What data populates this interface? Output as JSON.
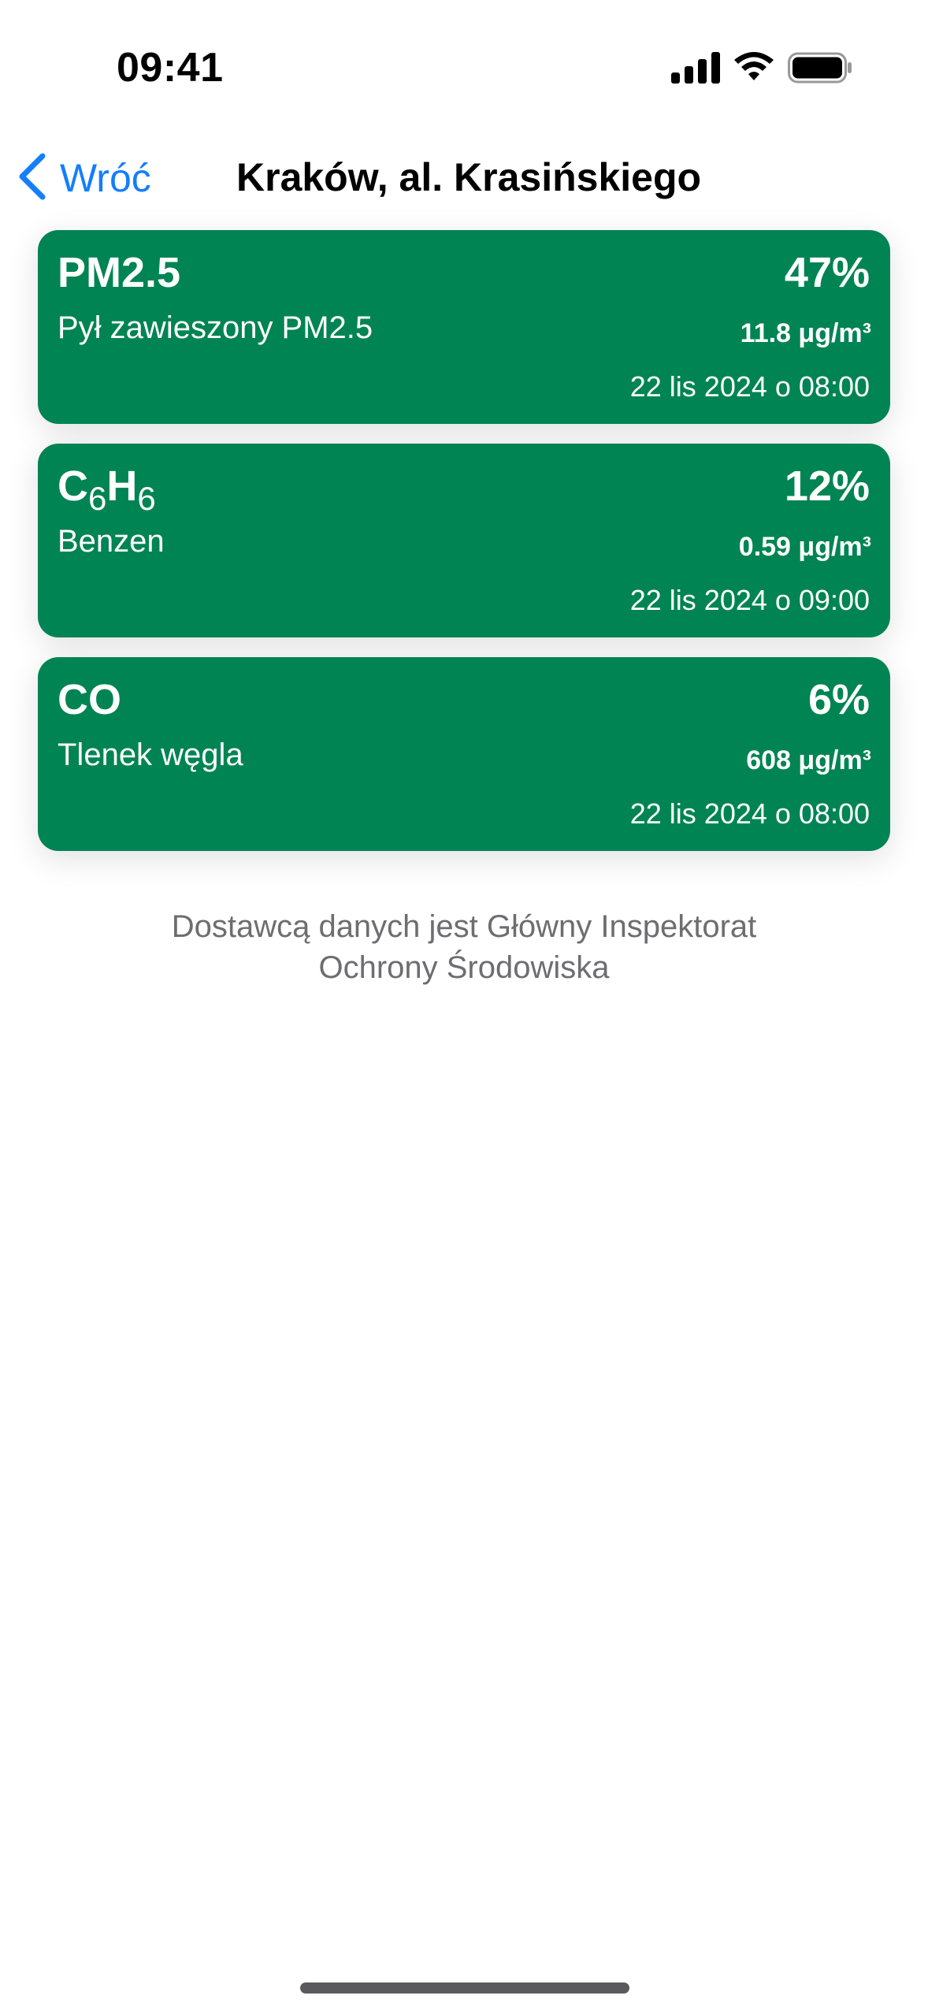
{
  "status_bar": {
    "time": "09:41",
    "icons": [
      "cellular-signal-icon",
      "wifi-icon",
      "battery-icon"
    ]
  },
  "nav": {
    "back_label": "Wróć",
    "title": "Kraków, al. Krasińskiego"
  },
  "colors": {
    "card_background": "#008453",
    "accent": "#147EFB",
    "credit_text": "#6d6d72"
  },
  "measurements": [
    {
      "symbol": "PM2.5",
      "symbol_main": "PM2.5",
      "name": "Pył zawieszony PM2.5",
      "percent": "47%",
      "value": "11.8 μg/m³",
      "date": "22 lis 2024 o 08:00"
    },
    {
      "symbol": "C6H6",
      "symbol_parts": [
        "C",
        "6",
        "H",
        "6"
      ],
      "name": "Benzen",
      "percent": "12%",
      "value": "0.59 μg/m³",
      "date": "22 lis 2024 o 09:00"
    },
    {
      "symbol": "CO",
      "symbol_main": "CO",
      "name": "Tlenek węgla",
      "percent": "6%",
      "value": "608 μg/m³",
      "date": "22 lis 2024 o 08:00"
    }
  ],
  "credit": {
    "line1": "Dostawcą danych jest Główny Inspektorat",
    "line2": "Ochrony Środowiska"
  }
}
